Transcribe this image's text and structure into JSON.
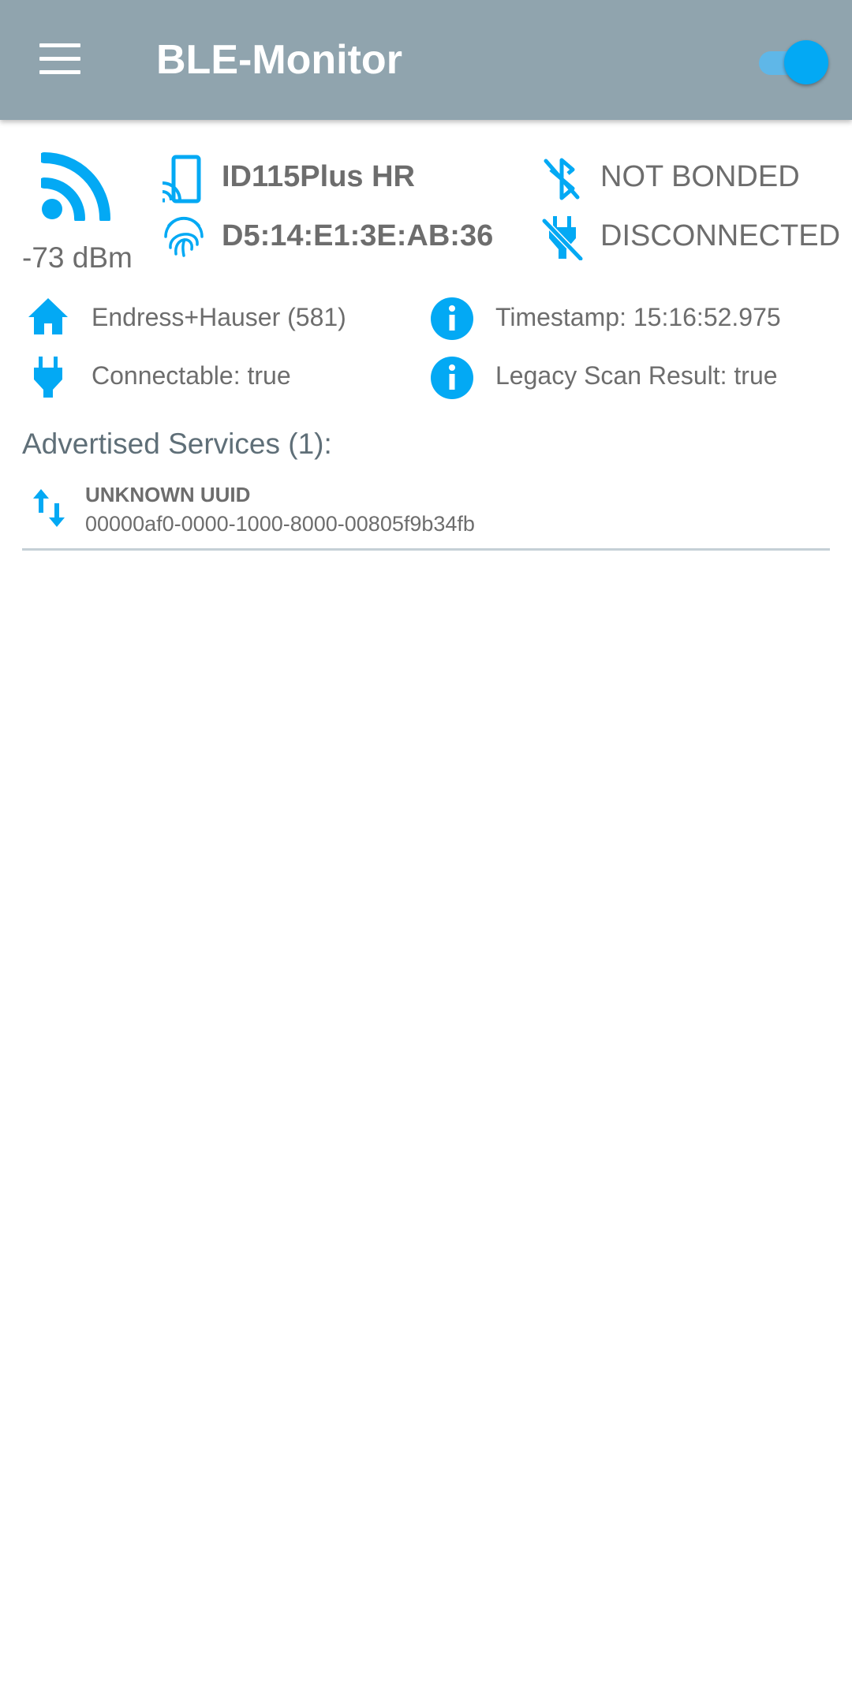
{
  "app": {
    "title": "BLE-Monitor",
    "scan_toggle_on": true,
    "colors": {
      "appbar": "#90a4ae",
      "accent": "#03a9f4",
      "text": "#6d6d6d"
    }
  },
  "device": {
    "rssi": "-73 dBm",
    "name": "ID115Plus HR",
    "address": "D5:14:E1:3E:AB:36",
    "bond_state": "NOT BONDED",
    "connection_state": "DISCONNECTED",
    "manufacturer": "Endress+Hauser (581)",
    "timestamp": "Timestamp: 15:16:52.975",
    "connectable": "Connectable: true",
    "legacy": "Legacy Scan Result: true"
  },
  "services": {
    "title": "Advertised Services (1):",
    "items": [
      {
        "name": "UNKNOWN UUID",
        "uuid": "00000af0-0000-1000-8000-00805f9b34fb"
      }
    ]
  },
  "icons": {
    "menu": "menu-icon",
    "signal": "signal-icon",
    "device": "device-cast-icon",
    "fingerprint": "fingerprint-icon",
    "bluetooth_off": "bluetooth-disabled-icon",
    "plug_off": "power-off-icon",
    "home": "home-icon",
    "info": "info-icon",
    "plug": "power-plug-icon",
    "swap": "swap-vertical-icon"
  }
}
